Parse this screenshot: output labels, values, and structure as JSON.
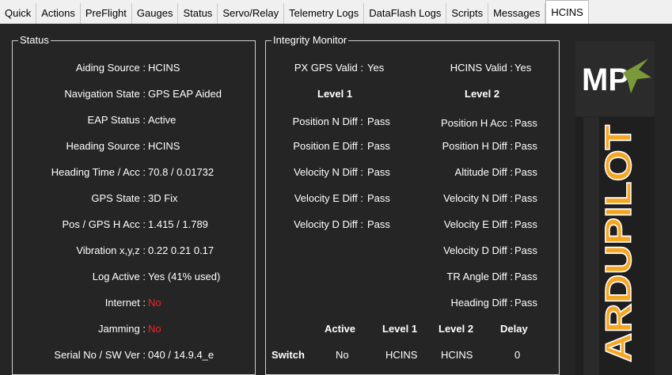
{
  "tabs": [
    "Quick",
    "Actions",
    "PreFlight",
    "Gauges",
    "Status",
    "Servo/Relay",
    "Telemetry Logs",
    "DataFlash Logs",
    "Scripts",
    "Messages",
    "HCINS"
  ],
  "status": {
    "title": "Status",
    "rows": [
      {
        "label": "Aiding Source :",
        "value": "HCINS"
      },
      {
        "label": "Navigation State :",
        "value": "GPS EAP Aided"
      },
      {
        "label": "EAP Status :",
        "value": "Active"
      },
      {
        "label": "Heading Source :",
        "value": "HCINS"
      },
      {
        "label": "Heading Time / Acc :",
        "value": "70.8 / 0.01732"
      },
      {
        "label": "GPS State :",
        "value": "3D Fix"
      },
      {
        "label": "Pos / GPS H Acc :",
        "value": "1.415 / 1.789"
      },
      {
        "label": "Vibration x,y,z :",
        "value": "0.22 0.21 0.17"
      },
      {
        "label": "Log Active :",
        "value": "Yes (41% used)"
      },
      {
        "label": "Internet :",
        "value": "No"
      },
      {
        "label": "Jamming :",
        "value": "No"
      },
      {
        "label": "Serial No / SW Ver :",
        "value": "040 / 14.9.4_e"
      }
    ]
  },
  "integrity": {
    "title": "Integrity Monitor",
    "px_gps_label": "PX GPS Valid :",
    "px_gps_value": "Yes",
    "hcins_label": "HCINS Valid :",
    "hcins_value": "Yes",
    "level1": "Level 1",
    "level2": "Level 2",
    "left_rows": [
      {
        "label": "Position N Diff :",
        "value": "Pass"
      },
      {
        "label": "Position E Diff :",
        "value": "Pass"
      },
      {
        "label": "Velocity N Diff :",
        "value": "Pass"
      },
      {
        "label": "Velocity E Diff :",
        "value": "Pass"
      },
      {
        "label": "Velocity D Diff :",
        "value": "Pass"
      }
    ],
    "right_rows": [
      {
        "label": "Position H Acc :",
        "value": "Pass"
      },
      {
        "label": "Position H Diff :",
        "value": "Pass"
      },
      {
        "label": "Altitude Diff :",
        "value": "Pass"
      },
      {
        "label": "Velocity N Diff :",
        "value": "Pass"
      },
      {
        "label": "Velocity E Diff :",
        "value": "Pass"
      },
      {
        "label": "Velocity D Diff :",
        "value": "Pass"
      },
      {
        "label": "TR Angle Diff :",
        "value": "Pass"
      },
      {
        "label": "Heading Diff :",
        "value": "Pass"
      }
    ],
    "switch_headers": [
      "Active",
      "Level 1",
      "Level 2",
      "Delay"
    ],
    "switch_label": "Switch",
    "switch_values": [
      "No",
      "HCINS",
      "HCINS",
      "0"
    ]
  },
  "logo": {
    "mp_text": "MP",
    "ardu_text": "ARDUPILOT"
  },
  "colors": {
    "panel_bg": "#252526",
    "alert": "#ff2020",
    "logo_orange": "#f5a623"
  }
}
